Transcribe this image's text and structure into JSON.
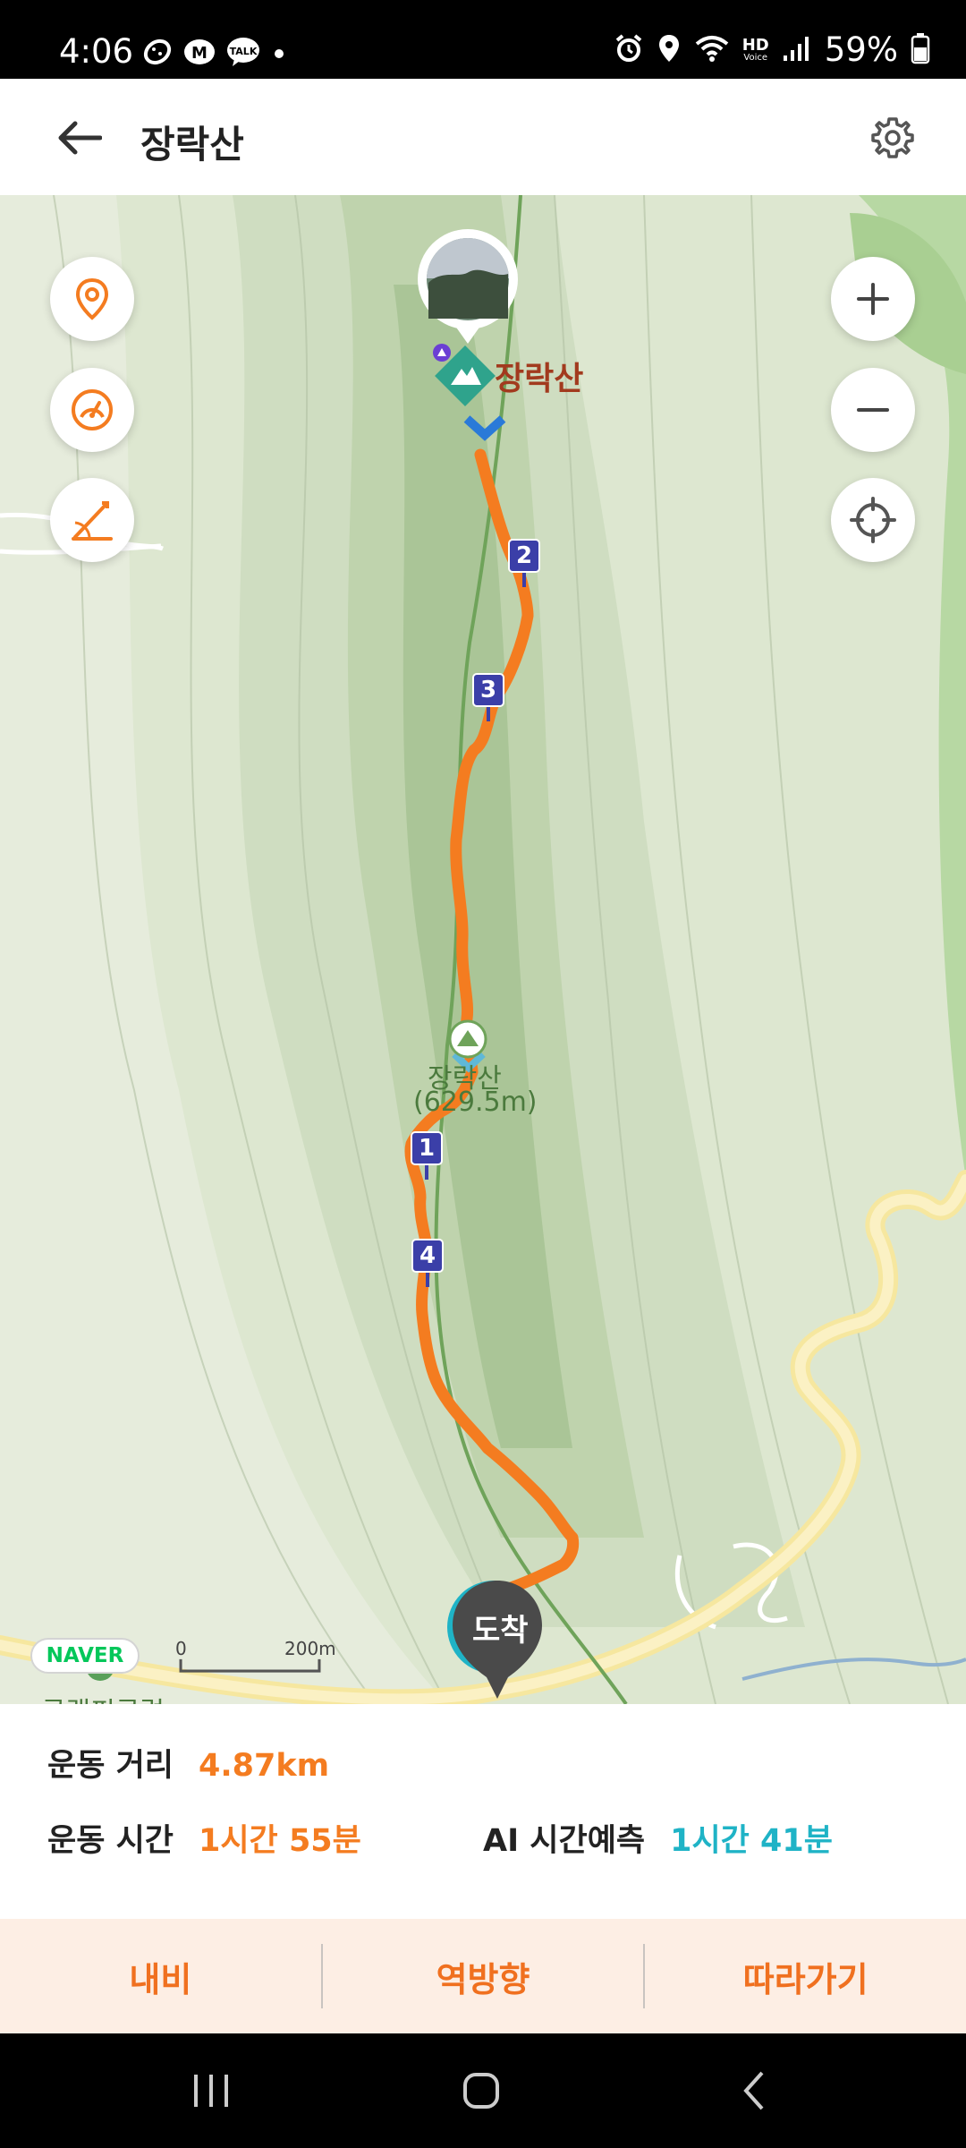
{
  "status_bar": {
    "time": "4:06",
    "left_icons": [
      "pedometer-icon",
      "m-icon",
      "talk-icon",
      "dot-icon"
    ],
    "talk_label": "TALK",
    "right_icons": [
      "alarm-icon",
      "location-icon",
      "wifi-icon",
      "hd-voice-icon",
      "signal-icon",
      "battery-icon"
    ],
    "hd_label": "HD",
    "voice_label": "Voice",
    "battery": "59%"
  },
  "header": {
    "title": "장락산",
    "back_icon": "back-arrow-icon",
    "settings_icon": "gear-icon"
  },
  "map": {
    "peak_marker_label": "장락산",
    "peak_name": "장락산",
    "peak_elevation": "(629.5m)",
    "checkpoints": [
      "2",
      "3",
      "1",
      "4"
    ],
    "arrival_label": "도착",
    "place_partial": "글램핑클럽",
    "naver_label": "NAVER",
    "scale_zero": "0",
    "scale_distance": "200m",
    "left_controls": [
      "location-pin-icon",
      "speedometer-icon",
      "slope-icon"
    ],
    "right_controls": [
      "zoom-in-icon",
      "zoom-out-icon",
      "gps-target-icon"
    ],
    "route_color": "#f47c20"
  },
  "stats": {
    "distance_label": "운동 거리",
    "distance_value": "4.87km",
    "time_label": "운동 시간",
    "time_value": "1시간 55분",
    "ai_label": "AI 시간예측",
    "ai_value": "1시간 41분"
  },
  "actions": {
    "nav": "내비",
    "reverse": "역방향",
    "follow": "따라가기"
  },
  "colors": {
    "accent_orange": "#f47c20",
    "teal": "#1fb3c6",
    "checkpoint_blue": "#3b3fa8"
  }
}
